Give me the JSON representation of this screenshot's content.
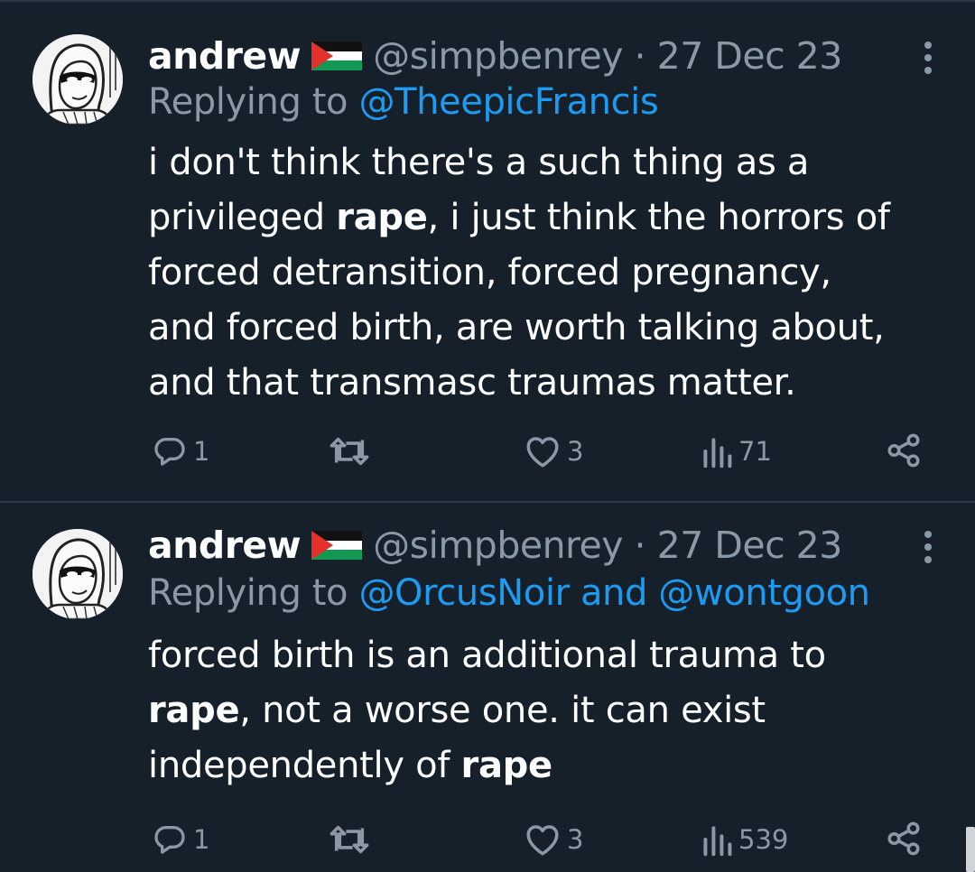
{
  "tweets": [
    {
      "name": "andrew",
      "handle_time": "@simpbenrey · 27 Dec 23",
      "replying_prefix": "Replying to ",
      "replying_to": "@TheepicFrancis",
      "text_lines": [
        [
          {
            "t": "i don't think there's a such thing as a",
            "b": false
          }
        ],
        [
          {
            "t": "privileged ",
            "b": false
          },
          {
            "t": "rape",
            "b": true
          },
          {
            "t": ", i just think the horrors of",
            "b": false
          }
        ],
        [
          {
            "t": "forced detransition, forced pregnancy,",
            "b": false
          }
        ],
        [
          {
            "t": "and forced birth, are worth talking about,",
            "b": false
          }
        ],
        [
          {
            "t": "and that transmasc traumas matter.",
            "b": false
          }
        ]
      ],
      "replies": "1",
      "likes": "3",
      "views": "71"
    },
    {
      "name": "andrew",
      "handle_time": "@simpbenrey · 27 Dec 23",
      "replying_prefix": "Replying to ",
      "replying_to": "@OrcusNoir and @wontgoon",
      "text_lines": [
        [
          {
            "t": "forced birth is an additional trauma to",
            "b": false
          }
        ],
        [
          {
            "t": "rape",
            "b": true
          },
          {
            "t": ", not a worse one. it can exist",
            "b": false
          }
        ],
        [
          {
            "t": "independently of ",
            "b": false
          },
          {
            "t": "rape",
            "b": true
          }
        ]
      ],
      "replies": "1",
      "likes": "3",
      "views": "539"
    }
  ],
  "icons": {
    "reply": "reply-icon",
    "retweet": "retweet-icon",
    "like": "heart-icon",
    "views": "views-icon",
    "share": "share-icon",
    "more": "more-icon",
    "flag": "palestine-flag-icon"
  },
  "colors": {
    "background": "#15202b",
    "text": "#ffffff",
    "muted": "#8b98a5",
    "accent": "#1d9bf0",
    "divider": "#2f3b47"
  }
}
